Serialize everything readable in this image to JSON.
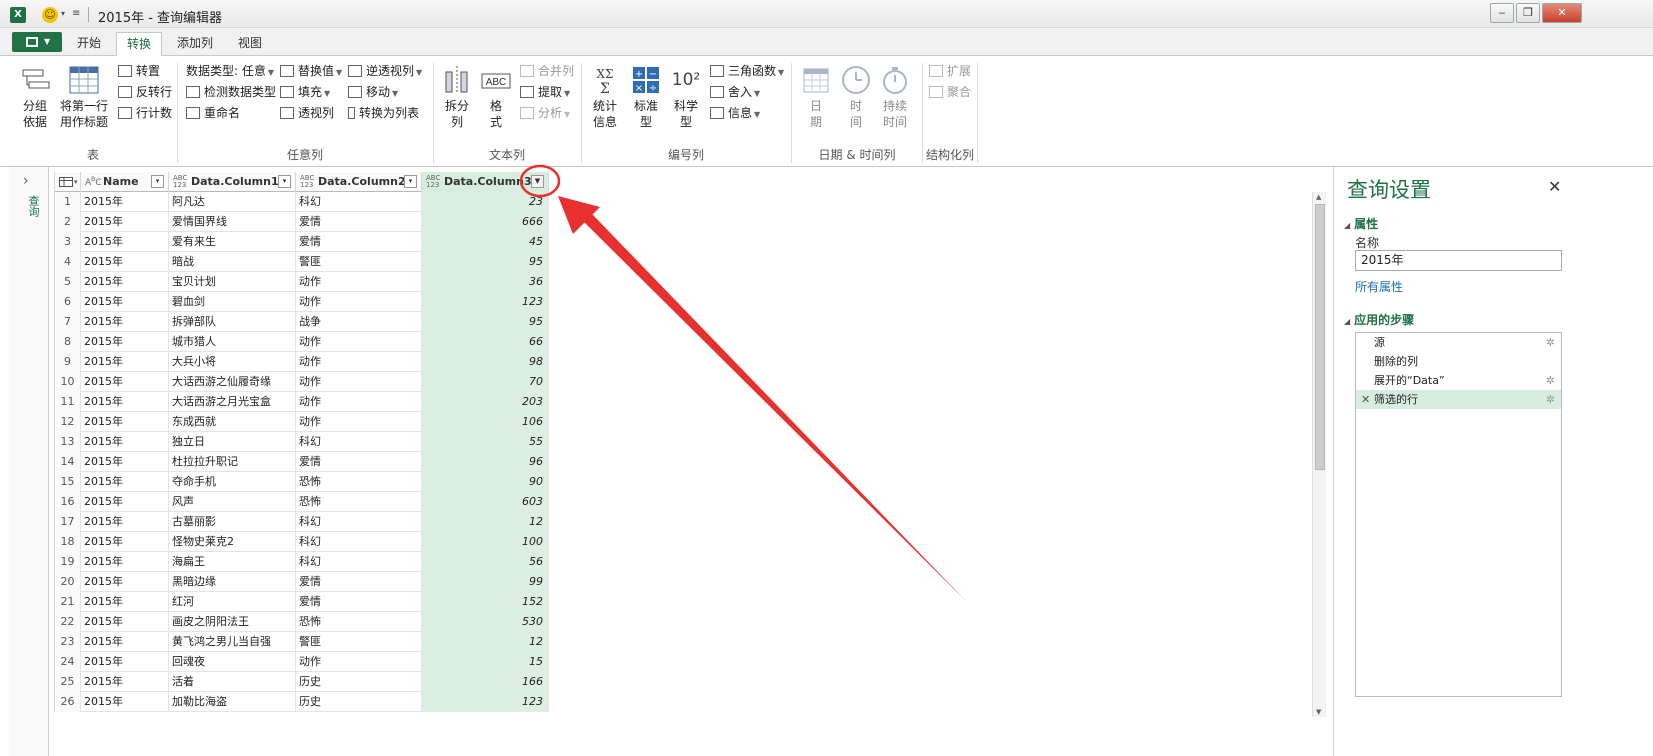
{
  "window": {
    "title": "2015年 - 查询编辑器",
    "min": "‒",
    "restore": "❐",
    "close": "✕"
  },
  "tabs": [
    "开始",
    "转换",
    "添加列",
    "视图"
  ],
  "ribbon": {
    "table_group": {
      "label": "表",
      "group_by": "分组\n依据",
      "use_first_row": "将第一行\n用作标题",
      "transpose": "转置",
      "reverse_rows": "反转行",
      "count_rows": "行计数"
    },
    "any_column_group": {
      "label": "任意列",
      "data_type": "数据类型: 任意",
      "detect_type": "检测数据类型",
      "rename": "重命名",
      "replace_values": "替换值",
      "fill": "填充",
      "pivot": "透视列",
      "unpivot": "逆透视列",
      "move": "移动",
      "convert_to_list": "转换为列表"
    },
    "text_group": {
      "label": "文本列",
      "split": "拆分\n列",
      "format": "格\n式",
      "merge": "合并列",
      "extract": "提取",
      "parse": "分析"
    },
    "number_group": {
      "label": "编号列",
      "statistics": "统计\n信息",
      "standard": "标准\n型",
      "scientific": "科学\n型",
      "scientific_icon": "10²",
      "trig": "三角函数",
      "rounding": "舍入",
      "information": "信息"
    },
    "date_group": {
      "label": "日期 & 时间列",
      "date": "日\n期",
      "time": "时\n间",
      "duration": "持续\n时间"
    },
    "struct_group": {
      "label": "结构化列",
      "expand": "扩展",
      "aggregate": "聚合"
    }
  },
  "left_strip": {
    "label": "查询"
  },
  "columns": [
    "Name",
    "Data.Column1",
    "Data.Column2",
    "Data.Column3"
  ],
  "rows": [
    [
      "1",
      "2015年",
      "阿凡达",
      "科幻",
      "23"
    ],
    [
      "2",
      "2015年",
      "爱情国界线",
      "爱情",
      "666"
    ],
    [
      "3",
      "2015年",
      "爱有来生",
      "爱情",
      "45"
    ],
    [
      "4",
      "2015年",
      "暗战",
      "警匪",
      "95"
    ],
    [
      "5",
      "2015年",
      "宝贝计划",
      "动作",
      "36"
    ],
    [
      "6",
      "2015年",
      "碧血剑",
      "动作",
      "123"
    ],
    [
      "7",
      "2015年",
      "拆弹部队",
      "战争",
      "95"
    ],
    [
      "8",
      "2015年",
      "城市猎人",
      "动作",
      "66"
    ],
    [
      "9",
      "2015年",
      "大兵小将",
      "动作",
      "98"
    ],
    [
      "10",
      "2015年",
      "大话西游之仙履奇缘",
      "动作",
      "70"
    ],
    [
      "11",
      "2015年",
      "大话西游之月光宝盒",
      "动作",
      "203"
    ],
    [
      "12",
      "2015年",
      "东成西就",
      "动作",
      "106"
    ],
    [
      "13",
      "2015年",
      "独立日",
      "科幻",
      "55"
    ],
    [
      "14",
      "2015年",
      "杜拉拉升职记",
      "爱情",
      "96"
    ],
    [
      "15",
      "2015年",
      "夺命手机",
      "恐怖",
      "90"
    ],
    [
      "16",
      "2015年",
      "风声",
      "恐怖",
      "603"
    ],
    [
      "17",
      "2015年",
      "古墓丽影",
      "科幻",
      "12"
    ],
    [
      "18",
      "2015年",
      "怪物史莱克2",
      "科幻",
      "100"
    ],
    [
      "19",
      "2015年",
      "海扁王",
      "科幻",
      "56"
    ],
    [
      "20",
      "2015年",
      "黑暗边缘",
      "爱情",
      "99"
    ],
    [
      "21",
      "2015年",
      "红河",
      "爱情",
      "152"
    ],
    [
      "22",
      "2015年",
      "画皮之阴阳法王",
      "恐怖",
      "530"
    ],
    [
      "23",
      "2015年",
      "黄飞鸿之男儿当自强",
      "警匪",
      "12"
    ],
    [
      "24",
      "2015年",
      "回魂夜",
      "动作",
      "15"
    ],
    [
      "25",
      "2015年",
      "活着",
      "历史",
      "166"
    ],
    [
      "26",
      "2015年",
      "加勒比海盗",
      "历史",
      "123"
    ]
  ],
  "query_settings": {
    "title": "查询设置",
    "close": "✕",
    "properties": "属性",
    "name_label": "名称",
    "name_value": "2015年",
    "all_properties": "所有属性",
    "applied_steps": "应用的步骤",
    "steps": [
      "源",
      "删除的列",
      "展开的“Data”",
      "筛选的行"
    ]
  },
  "colors": {
    "accent": "#1e7145",
    "annotation": "#e8302e",
    "column_highlight": "#dcefe2"
  }
}
